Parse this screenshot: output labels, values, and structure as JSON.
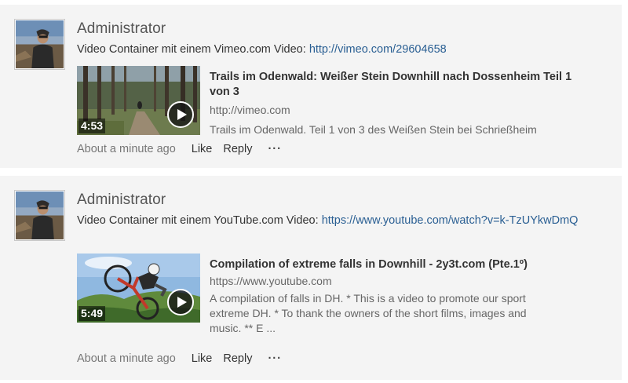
{
  "posts": [
    {
      "author": "Administrator",
      "message_prefix": "Video Container mit einem Vimeo.com Video: ",
      "message_link": "http://vimeo.com/29604658",
      "embed": {
        "title": "Trails im Odenwald: Weißer Stein Downhill nach Dossenheim Teil 1 von 3",
        "source": "http://vimeo.com",
        "description": "Trails im Odenwald. Teil 1 von 3 des Weißen Stein bei Schrießheim",
        "duration": "4:53",
        "play_icon": "play-icon"
      },
      "timestamp": "About a minute ago",
      "like_label": "Like",
      "reply_label": "Reply",
      "more_label": "···"
    },
    {
      "author": "Administrator",
      "message_prefix": "Video Container mit einem YouTube.com Video: ",
      "message_link": "https://www.youtube.com/watch?v=k-TzUYkwDmQ",
      "embed": {
        "title": "Compilation of extreme falls in Downhill - 2y3t.com (Pte.1º)",
        "source": "https://www.youtube.com",
        "description": "A compilation of falls in DH. * This is a video to promote our sport extreme DH. * To thank the owners of the short films, images and music. ** E ...",
        "duration": "5:49",
        "play_icon": "play-icon"
      },
      "timestamp": "About a minute ago",
      "like_label": "Like",
      "reply_label": "Reply",
      "more_label": "···"
    }
  ],
  "colors": {
    "post_background": "#f4f4f4",
    "link": "#2a5f93",
    "text": "#333333",
    "muted": "#777777"
  }
}
